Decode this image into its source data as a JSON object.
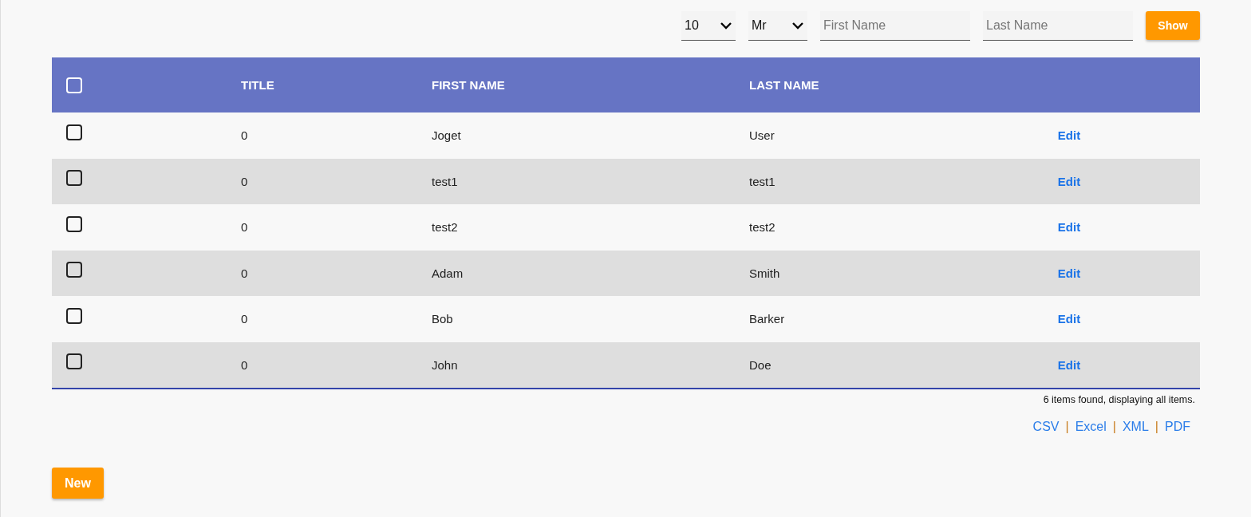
{
  "filters": {
    "page_size": "10",
    "title": "Mr",
    "first_name": {
      "placeholder": "First Name"
    },
    "last_name": {
      "placeholder": "Last Name"
    },
    "show_button": "Show"
  },
  "table": {
    "select_all": {
      "checked": false
    },
    "columns": [
      "TITLE",
      "FIRST NAME",
      "LAST NAME"
    ],
    "rows": [
      {
        "checked": false,
        "title": "0",
        "first_name": "Joget",
        "last_name": "User",
        "action": "Edit"
      },
      {
        "checked": false,
        "title": "0",
        "first_name": "test1",
        "last_name": "test1",
        "action": "Edit"
      },
      {
        "checked": false,
        "title": "0",
        "first_name": "test2",
        "last_name": "test2",
        "action": "Edit"
      },
      {
        "checked": false,
        "title": "0",
        "first_name": "Adam",
        "last_name": "Smith",
        "action": "Edit"
      },
      {
        "checked": false,
        "title": "0",
        "first_name": "Bob",
        "last_name": "Barker",
        "action": "Edit"
      },
      {
        "checked": false,
        "title": "0",
        "first_name": "John",
        "last_name": "Doe",
        "action": "Edit"
      }
    ]
  },
  "status": "6 items found, displaying all items.",
  "exports": [
    {
      "label": "CSV",
      "separator": "|"
    },
    {
      "label": "Excel",
      "separator": "|"
    },
    {
      "label": "XML",
      "separator": "|"
    },
    {
      "label": "PDF"
    }
  ],
  "new_button": "New"
}
